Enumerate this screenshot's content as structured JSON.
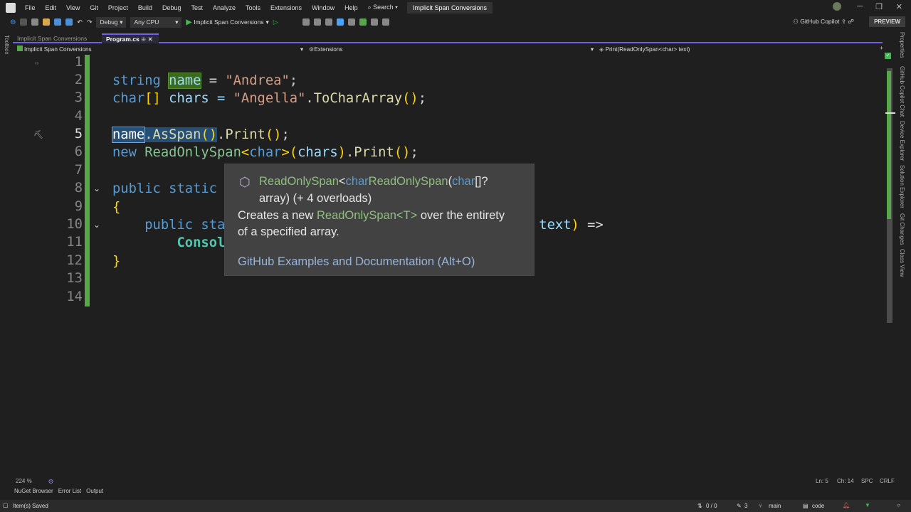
{
  "menu": [
    "File",
    "Edit",
    "View",
    "Git",
    "Project",
    "Build",
    "Debug",
    "Test",
    "Analyze",
    "Tools",
    "Extensions",
    "Window",
    "Help"
  ],
  "search_label": "Search",
  "window_title": "Implicit Span Conversions",
  "toolbar": {
    "config": "Debug",
    "platform": "Any CPU",
    "run_target": "Implicit Span Conversions",
    "copilot": "GitHub Copilot",
    "preview": "PREVIEW"
  },
  "toolbox_label": "Toolbox",
  "tabs": [
    {
      "label": "Implicit Span Conversions"
    },
    {
      "label": "Program.cs",
      "pin": "⊕",
      "close": "✕"
    }
  ],
  "navbar": {
    "project": "Implicit Span Conversions",
    "type": "Extensions",
    "member": "Print(ReadOnlySpan<char> text)"
  },
  "right_tabs": [
    "Properties",
    "GitHub Copilot Chat",
    "Device Explorer",
    "Solution Explorer",
    "Git Changes",
    "Class View"
  ],
  "line_numbers": [
    "1",
    "2",
    "3",
    "4",
    "5",
    "6",
    "7",
    "8",
    "9",
    "10",
    "11",
    "12",
    "13",
    "14"
  ],
  "code": {
    "l2": [
      "string",
      " ",
      "name",
      " = ",
      "\"Andrea\"",
      ";"
    ],
    "l3": [
      "char",
      "[]",
      " chars = ",
      "\"Angella\"",
      ".",
      "ToCharArray",
      "()",
      ";"
    ],
    "l5": [
      "name",
      ".",
      "AsSpan",
      "()",
      ".",
      "Print",
      "()",
      ";"
    ],
    "l6": [
      "new",
      " ",
      "ReadOnlySpan",
      "<",
      "char",
      ">",
      "(",
      "chars",
      ")",
      ".",
      "Print",
      "()",
      ";"
    ],
    "l8": [
      "public static"
    ],
    "l9": [
      "{"
    ],
    "l10": [
      "public sta",
      "text",
      ")",
      " =>"
    ],
    "l11": [
      "Consol"
    ],
    "l12": [
      "}"
    ]
  },
  "tooltip": {
    "sig1": "ReadOnlySpan",
    "sig2": "<",
    "sig3": "char",
    ">.": ">.",
    "sig4": "ReadOnlySpan",
    "sig5": "(",
    "sig6": "char",
    "sig7": "[]?",
    "sig8": "array) (+ 4 overloads)",
    "desc1": "Creates a new ",
    "desc2": "ReadOnlySpan<T>",
    "desc3": " over the entirety",
    "desc4": "of a specified array.",
    "link": "GitHub Examples and Documentation (Alt+O)"
  },
  "editor_status": {
    "zoom": "224 %",
    "line": "Ln: 5",
    "col": "Ch: 14",
    "spaces": "SPC",
    "eol": "CRLF"
  },
  "bottom_tabs": [
    "NuGet Browser",
    "Error List",
    "Output"
  ],
  "status": {
    "message": "Item(s) Saved",
    "errors": "0 / 0",
    "changes": "3",
    "branch": "main",
    "repo": "code"
  }
}
